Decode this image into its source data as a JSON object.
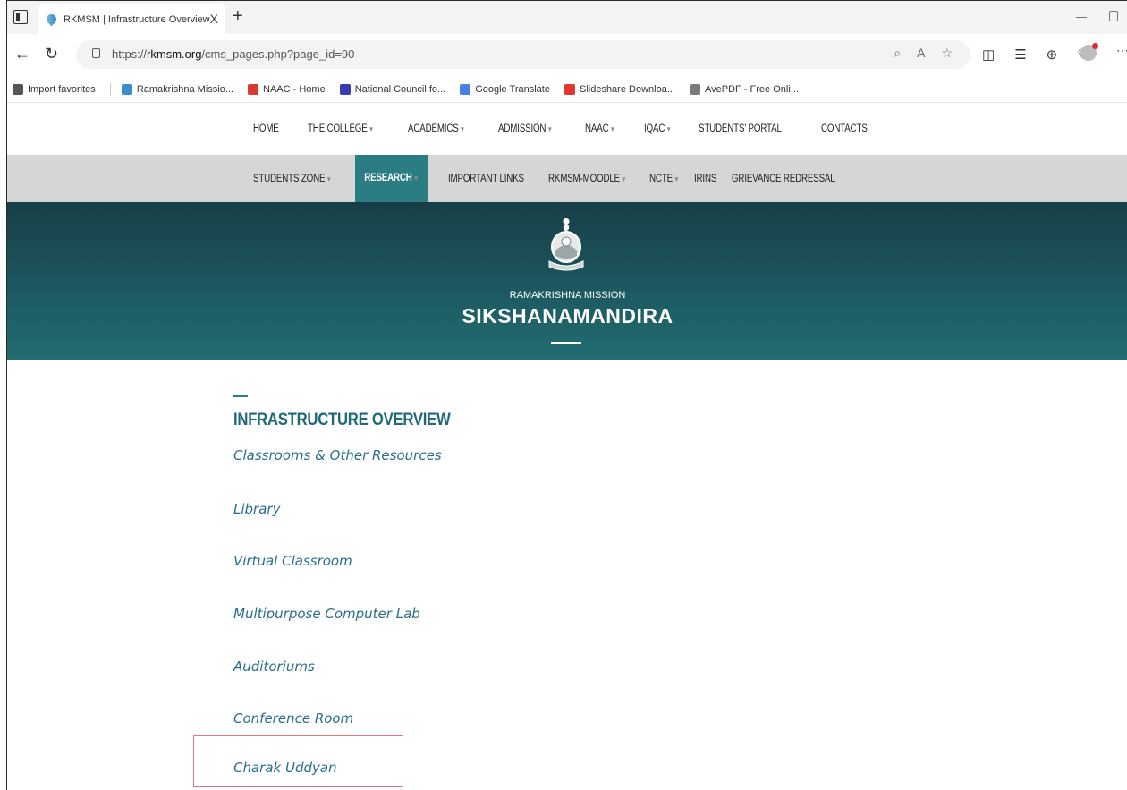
{
  "browser": {
    "tab_title": "RKMSM | Infrastructure Overview",
    "tab_close": "X",
    "new_tab": "+",
    "url_prefix": "https://",
    "url_host": "rkmsm.org",
    "url_path": "/cms_pages.php?page_id=90"
  },
  "bookmarks": [
    {
      "label": "Import favorites",
      "color": "#555555"
    },
    {
      "label": "Ramakrishna Missio...",
      "color": "#3a8ecb"
    },
    {
      "label": "NAAC - Home",
      "color": "#d83b2e"
    },
    {
      "label": "National Council fo...",
      "color": "#3b3bb0"
    },
    {
      "label": "Google Translate",
      "color": "#4a7ee8"
    },
    {
      "label": "Slideshare Downloa...",
      "color": "#e0362c"
    },
    {
      "label": "AvePDF - Free Onli...",
      "color": "#7a7a7a"
    }
  ],
  "nav1": [
    {
      "label": "HOME",
      "caret": ""
    },
    {
      "label": "THE COLLEGE",
      "caret": "▾"
    },
    {
      "label": "ACADEMICS",
      "caret": "▾"
    },
    {
      "label": "ADMISSION",
      "caret": "▾"
    },
    {
      "label": "NAAC",
      "caret": "▾"
    },
    {
      "label": "IQAC",
      "caret": "▾"
    },
    {
      "label": "STUDENTS' PORTAL",
      "caret": ""
    },
    {
      "label": "CONTACTS",
      "caret": ""
    }
  ],
  "nav2": [
    {
      "label": "STUDENTS ZONE",
      "caret": "▾",
      "active": false
    },
    {
      "label": "RESEARCH",
      "caret": "▾",
      "active": true
    },
    {
      "label": "IMPORTANT LINKS",
      "caret": "",
      "active": false
    },
    {
      "label": "RKMSM-MOODLE",
      "caret": "▾",
      "active": false
    },
    {
      "label": "NCTE",
      "caret": "▾",
      "active": false
    },
    {
      "label": "IRINS",
      "caret": "",
      "active": false
    },
    {
      "label": "GRIEVANCE REDRESSAL",
      "caret": "",
      "active": false
    }
  ],
  "banner": {
    "subtitle": "RAMAKRISHNA MISSION",
    "title": "SIKSHANAMANDIRA"
  },
  "section": {
    "title": "INFRASTRUCTURE OVERVIEW",
    "links": [
      "Classrooms & Other Resources",
      "Library",
      "Virtual Classroom",
      "Multipurpose Computer Lab",
      "Auditoriums",
      "Conference Room",
      "Charak Uddyan"
    ]
  },
  "colors": {
    "accent": "#2a7d82",
    "link": "#2a6e8c",
    "banner": "#1d5860",
    "highlight": "#e8747c"
  }
}
